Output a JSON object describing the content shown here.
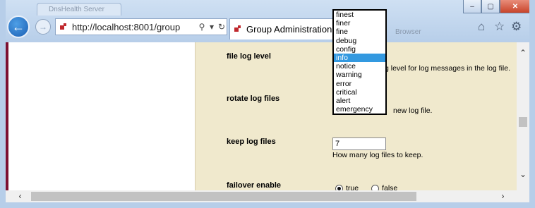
{
  "browser": {
    "background_tab_title": "DnsHealth Server",
    "background_tab_right_title": "Browser",
    "address_url": "http://localhost:8001/group",
    "active_tab_title": "Group Administration",
    "window_buttons": [
      "–",
      "▢",
      "✕"
    ]
  },
  "settings": {
    "file_log_level": {
      "label": "file log level",
      "help": "Log level for log messages in the log file.",
      "help_visible": "g level for log messages in the log file."
    },
    "rotate_log_files": {
      "label": "rotate log files",
      "help_visible": "new log file."
    },
    "keep_log_files": {
      "label": "keep log files",
      "value": "7",
      "help": "How many log files to keep."
    },
    "failover_enable": {
      "label": "failover enable",
      "options": [
        "true",
        "false"
      ],
      "selected": "true"
    }
  },
  "dropdown": {
    "options": [
      "finest",
      "finer",
      "fine",
      "debug",
      "config",
      "info",
      "notice",
      "warning",
      "error",
      "critical",
      "alert",
      "emergency"
    ],
    "selected_index": 5
  },
  "colors": {
    "content_bg": "#f0e9cd",
    "accent_bar": "#7d1131",
    "selection": "#3399e0"
  }
}
